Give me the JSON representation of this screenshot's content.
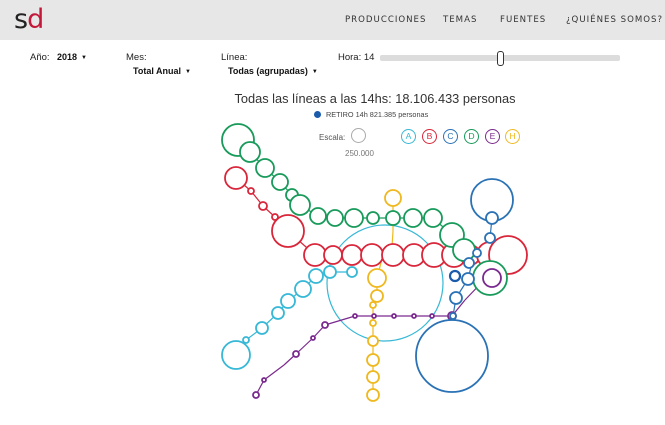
{
  "header": {
    "logo_s": "s",
    "logo_d": "d",
    "nav": [
      "PRODUCCIONES",
      "TEMAS",
      "FUENTES",
      "¿QUIÉNES SOMOS?"
    ]
  },
  "controls": {
    "year_label": "Año:",
    "year_value": "2018",
    "month_label": "Mes:",
    "month_value": "Total Anual",
    "line_label": "Línea:",
    "line_value": "Todas (agrupadas)",
    "hour_label": "Hora: 14",
    "hour_value": 14,
    "dropdown_arrow": "▼"
  },
  "chart_title": "Todas las líneas a las 14hs: 18.106.433 personas",
  "highlight": "RETIRO 14h 821.385 personas",
  "scale": {
    "label": "Escala:",
    "value": "250.000"
  },
  "lines": [
    {
      "id": "A",
      "color": "#36b8d6"
    },
    {
      "id": "B",
      "color": "#d9263a"
    },
    {
      "id": "C",
      "color": "#2a72b5"
    },
    {
      "id": "D",
      "color": "#189a5a"
    },
    {
      "id": "E",
      "color": "#7a2a8e"
    },
    {
      "id": "H",
      "color": "#f0b81f"
    }
  ],
  "colors": {
    "highlight_dot": "#1a5bab",
    "logo_accent": "#c2183a"
  }
}
